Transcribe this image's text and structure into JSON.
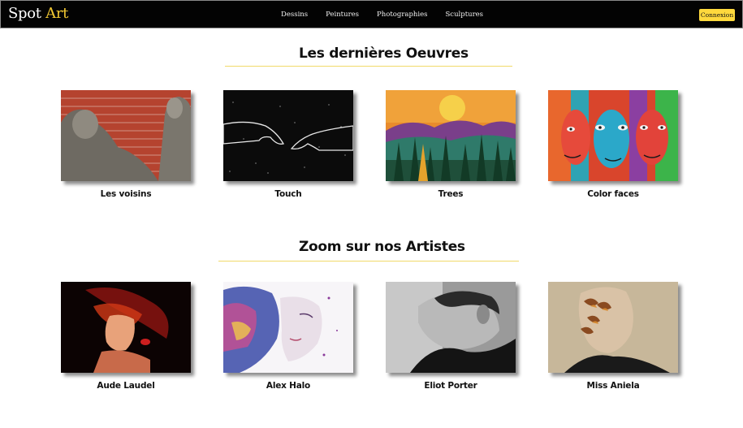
{
  "header": {
    "brand_part1": "Spot ",
    "brand_part2": "Art",
    "nav": [
      "Dessins",
      "Peintures",
      "Photographies",
      "Sculptures"
    ],
    "login_label": "Connexion"
  },
  "works_section": {
    "title": "Les dernières Oeuvres",
    "items": [
      {
        "title": "Les voisins",
        "image": "sculpture-peeking-men"
      },
      {
        "title": "Touch",
        "image": "reaching-hands-starfield"
      },
      {
        "title": "Trees",
        "image": "sunset-forest-painting"
      },
      {
        "title": "Color faces",
        "image": "colorful-faces-painting"
      }
    ]
  },
  "artists_section": {
    "title": "Zoom sur nos Artistes",
    "items": [
      {
        "name": "Aude Laudel",
        "image": "red-smoke-portrait"
      },
      {
        "name": "Alex Halo",
        "image": "watercolor-woman-profile"
      },
      {
        "name": "Eliot Porter",
        "image": "bw-man-profile"
      },
      {
        "name": "Miss Aniela",
        "image": "butterfly-face-portrait"
      }
    ]
  },
  "colors": {
    "navbar": "#030303",
    "accent": "#f3c932",
    "button": "#ffd93d"
  }
}
